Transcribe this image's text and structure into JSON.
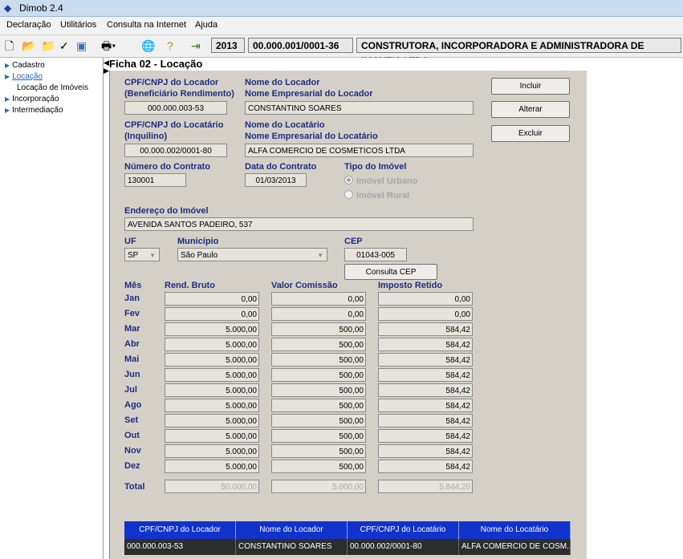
{
  "window": {
    "title": "Dimob 2.4"
  },
  "menu": [
    "Declaração",
    "Utilitários",
    "Consulta na Internet",
    "Ajuda"
  ],
  "toolbar": {
    "year": "2013",
    "cnpj": "00.000.001/0001-36",
    "company": "CONSTRUTORA, INCORPORADORA E ADMINISTRADORA DE IMOVEIS LTDA."
  },
  "tree": {
    "cadastro": "Cadastro",
    "locacao": "Locação",
    "locacao_imoveis": "Locação de Imóveis",
    "incorporacao": "Incorporação",
    "intermediacao": "Intermediação"
  },
  "form": {
    "title": "Ficha 02 - Locação",
    "cpf_locador_label_1": "CPF/CNPJ do Locador",
    "cpf_locador_label_2": "(Beneficiário Rendimento)",
    "cpf_locador": "000.000.003-53",
    "nome_locador_label_1": "Nome do Locador",
    "nome_locador_label_2": "Nome Empresarial do Locador",
    "nome_locador": "CONSTANTINO SOARES",
    "cpf_locatario_label_1": "CPF/CNPJ do Locatário",
    "cpf_locatario_label_2": "(Inquilino)",
    "cpf_locatario": "00.000.002/0001-80",
    "nome_locatario_label_1": "Nome do Locatário",
    "nome_locatario_label_2": "Nome Empresarial do Locatário",
    "nome_locatario": "ALFA COMERCIO DE COSMETICOS LTDA",
    "numero_contrato_label": "Número do Contrato",
    "numero_contrato": "130001",
    "data_contrato_label": "Data do Contrato",
    "data_contrato": "01/03/2013",
    "tipo_imovel_label": "Tipo do Imóvel",
    "tipo_urbano": "Imóvel Urbano",
    "tipo_rural": "Imóvel Rural",
    "endereco_label": "Endereço do Imóvel",
    "endereco": "AVENIDA SANTOS PADEIRO, 537",
    "uf_label": "UF",
    "uf": "SP",
    "municipio_label": "Município",
    "municipio": "São Paulo",
    "cep_label": "CEP",
    "cep": "01043-005",
    "consulta_cep": "Consulta CEP"
  },
  "buttons": {
    "incluir": "Incluir",
    "alterar": "Alterar",
    "excluir": "Excluir"
  },
  "table": {
    "col_mes": "Mês",
    "col_rend": "Rend. Bruto",
    "col_comissao": "Valor Comissão",
    "col_imposto": "Imposto Retido",
    "months": [
      "Jan",
      "Fev",
      "Mar",
      "Abr",
      "Mai",
      "Jun",
      "Jul",
      "Ago",
      "Set",
      "Out",
      "Nov",
      "Dez"
    ],
    "rend": [
      "0,00",
      "0,00",
      "5.000,00",
      "5.000,00",
      "5.000,00",
      "5.000,00",
      "5.000,00",
      "5.000,00",
      "5.000,00",
      "5.000,00",
      "5.000,00",
      "5.000,00"
    ],
    "comissao": [
      "0,00",
      "0,00",
      "500,00",
      "500,00",
      "500,00",
      "500,00",
      "500,00",
      "500,00",
      "500,00",
      "500,00",
      "500,00",
      "500,00"
    ],
    "imposto": [
      "0,00",
      "0,00",
      "584,42",
      "584,42",
      "584,42",
      "584,42",
      "584,42",
      "584,42",
      "584,42",
      "584,42",
      "584,42",
      "584,42"
    ],
    "total_label": "Total",
    "total_rend": "50.000,00",
    "total_comissao": "5.000,00",
    "total_imposto": "5.844,20"
  },
  "grid": {
    "headers": [
      "CPF/CNPJ do Locador",
      "Nome do Locador",
      "CPF/CNPJ do Locatário",
      "Nome do Locatário"
    ],
    "row": [
      "000.000.003-53",
      "CONSTANTINO SOARES",
      "00.000.002/0001-80",
      "ALFA COMERCIO DE COSM..."
    ]
  }
}
